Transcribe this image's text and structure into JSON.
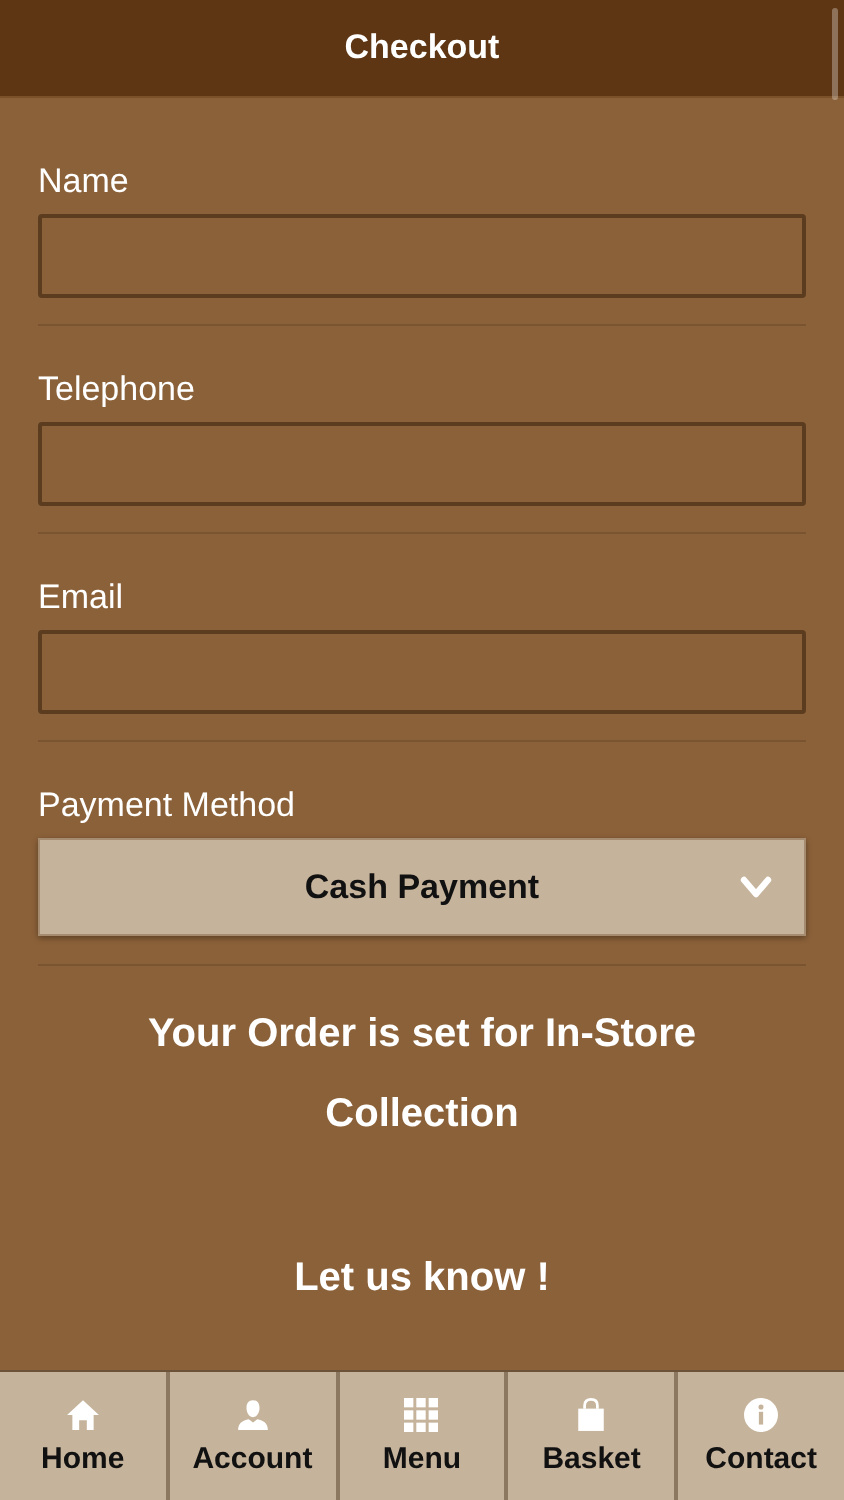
{
  "header": {
    "title": "Checkout"
  },
  "fields": [
    {
      "label": "Name",
      "kind": "text"
    },
    {
      "label": "Telephone",
      "kind": "text"
    },
    {
      "label": "Email",
      "kind": "text"
    },
    {
      "label": "Payment Method",
      "kind": "select",
      "value": "Cash Payment"
    }
  ],
  "notice": "Your Order is set for In-Store Collection",
  "section_title": "Let us know !",
  "nav": [
    {
      "label": "Home"
    },
    {
      "label": "Account"
    },
    {
      "label": "Menu"
    },
    {
      "label": "Basket"
    },
    {
      "label": "Contact"
    }
  ]
}
